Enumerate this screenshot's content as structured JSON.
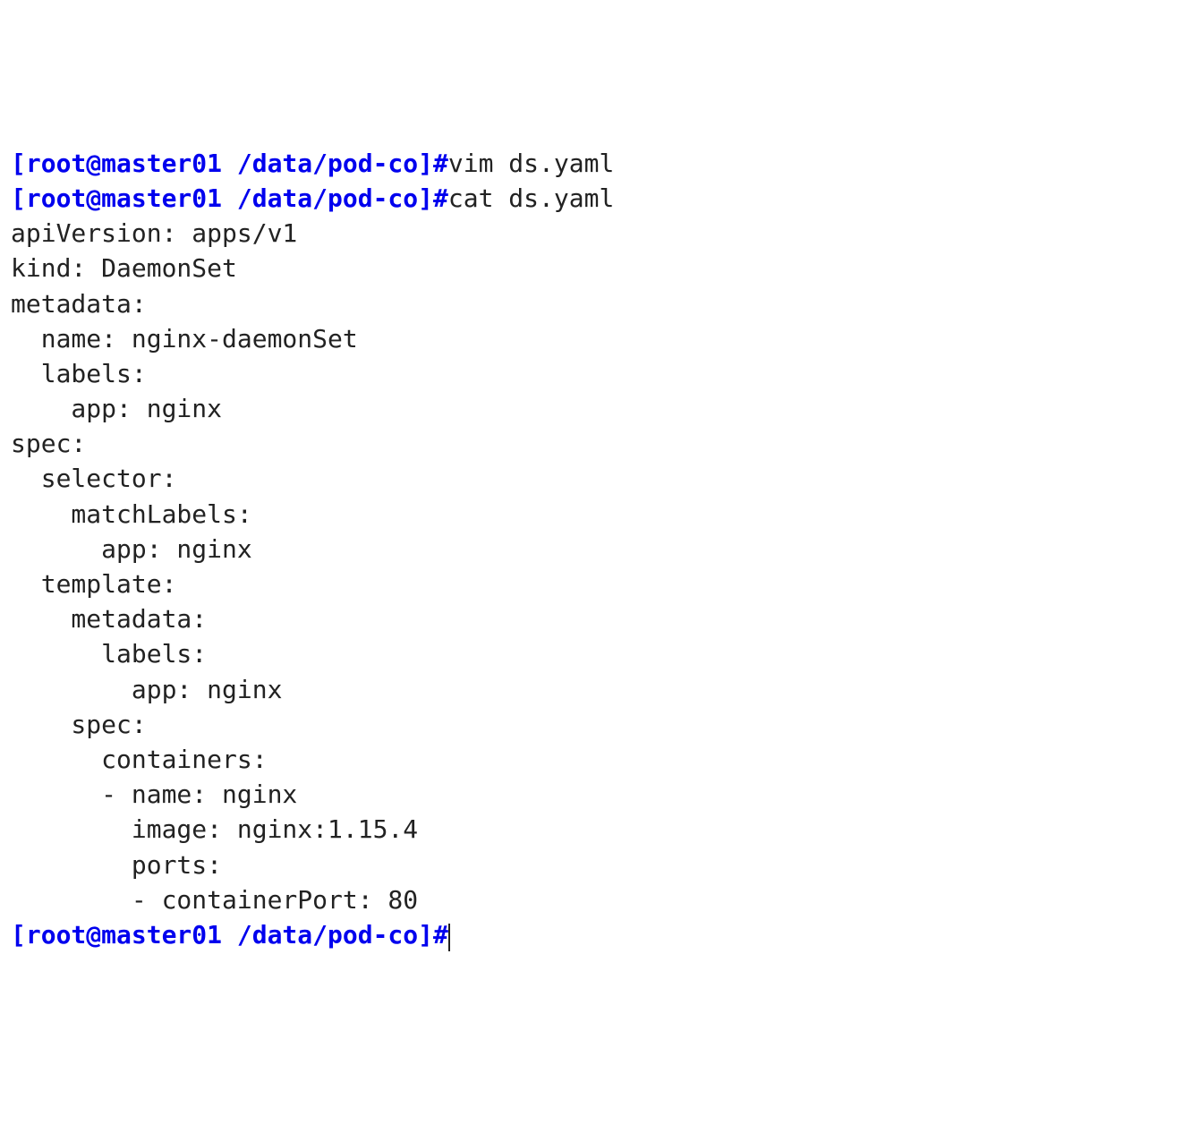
{
  "prompt": "[root@master01 /data/pod-co]#",
  "cmd1": "vim ds.yaml",
  "cmd2": "cat ds.yaml",
  "yaml": {
    "l01": "apiVersion: apps/v1",
    "l02": "kind: DaemonSet",
    "l03": "metadata:",
    "l04": "  name: nginx-daemonSet",
    "l05": "  labels:",
    "l06": "    app: nginx",
    "l07": "spec:",
    "l08": "  selector:",
    "l09": "    matchLabels:",
    "l10": "      app: nginx",
    "l11": "  template:",
    "l12": "    metadata:",
    "l13": "      labels:",
    "l14": "        app: nginx",
    "l15": "    spec:",
    "l16": "      containers:",
    "l17": "      - name: nginx",
    "l18": "        image: nginx:1.15.4",
    "l19": "        ports:",
    "l20": "        - containerPort: 80"
  }
}
